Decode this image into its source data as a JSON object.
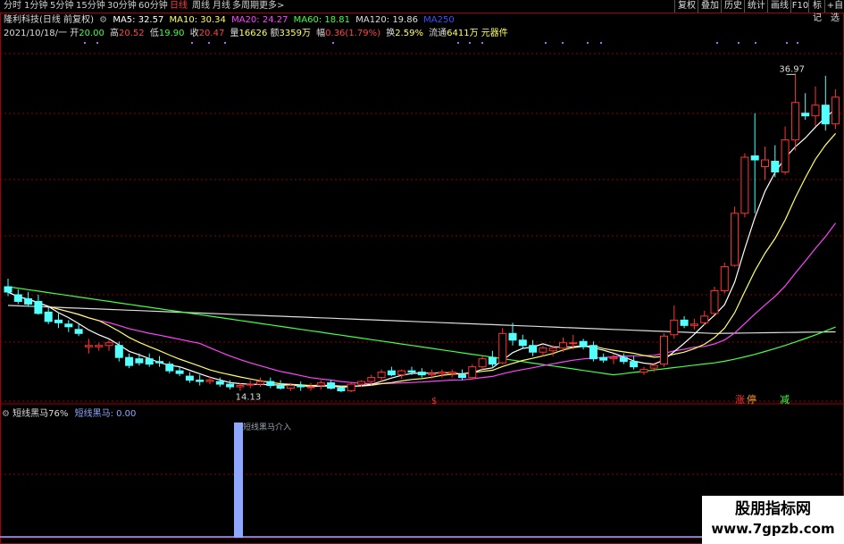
{
  "timeframes": [
    {
      "label": "分时",
      "active": false
    },
    {
      "label": "1分钟",
      "active": false
    },
    {
      "label": "5分钟",
      "active": false
    },
    {
      "label": "15分钟",
      "active": false
    },
    {
      "label": "30分钟",
      "active": false
    },
    {
      "label": "60分钟",
      "active": false
    },
    {
      "label": "日线",
      "active": true
    },
    {
      "label": "周线",
      "active": false
    },
    {
      "label": "月线",
      "active": false
    },
    {
      "label": "多周期",
      "active": false
    },
    {
      "label": "更多>",
      "active": false
    }
  ],
  "right_buttons": [
    "复权",
    "叠加",
    "历史",
    "统计",
    "画线",
    "F10",
    "标记",
    "+自选"
  ],
  "stock_title": "隆利科技(日线 前复权)",
  "ma_legend": [
    {
      "label": "MA5: 32.57",
      "color": "#ffffff"
    },
    {
      "label": "MA10: 30.34",
      "color": "#ffff66"
    },
    {
      "label": "MA20: 24.27",
      "color": "#ff44ff"
    },
    {
      "label": "MA60: 18.81",
      "color": "#44ff44"
    },
    {
      "label": "MA120: 19.86",
      "color": "#dddddd"
    },
    {
      "label": "MA250",
      "color": "#3355ff"
    }
  ],
  "quote": {
    "date": "2021/10/18/一",
    "open_label": "开",
    "open": "20.00",
    "high_label": "高",
    "high": "20.52",
    "low_label": "低",
    "low": "19.90",
    "close_label": "收",
    "close": "20.47",
    "vol_label": "量",
    "vol": "16626",
    "amount_label": "额",
    "amount": "3359万",
    "chg_label": "幅",
    "chg": "0.36(1.79%)",
    "turnover_label": "换",
    "turnover": "2.59%",
    "float_label": "流通",
    "float": "6411万",
    "sector": "元器件"
  },
  "price_labels": {
    "high": "36.97",
    "low": "14.13"
  },
  "markers": {
    "s": "$",
    "zhang": "涨",
    "ting": "停",
    "yu": "减"
  },
  "indicator": {
    "name": "短线黑马76%",
    "value_label": "短线黑马: 0.00",
    "bar_text": "短线黑马介入"
  },
  "colors": {
    "up": "#ff3333",
    "down": "#54ffff",
    "ma5": "#ffffff",
    "ma10": "#ffff66",
    "ma20": "#ff44ff",
    "ma60": "#44ff44",
    "ma120": "#dddddd",
    "grid": "#8b0000",
    "bar": "#8fa8ff"
  },
  "chart_data": {
    "type": "candlestick",
    "ylim": [
      12.5,
      39
    ],
    "candles": [
      {
        "o": 21.0,
        "h": 21.6,
        "l": 20.3,
        "c": 20.6
      },
      {
        "o": 20.4,
        "h": 20.8,
        "l": 19.7,
        "c": 19.9
      },
      {
        "o": 20.1,
        "h": 20.6,
        "l": 19.5,
        "c": 19.7
      },
      {
        "o": 19.9,
        "h": 20.4,
        "l": 18.9,
        "c": 19.0
      },
      {
        "o": 19.1,
        "h": 19.5,
        "l": 18.2,
        "c": 18.4
      },
      {
        "o": 18.5,
        "h": 19.0,
        "l": 17.9,
        "c": 18.3
      },
      {
        "o": 18.2,
        "h": 18.5,
        "l": 17.6,
        "c": 18.0
      },
      {
        "o": 17.8,
        "h": 18.2,
        "l": 17.3,
        "c": 17.5
      },
      {
        "o": 16.5,
        "h": 17.1,
        "l": 16.0,
        "c": 16.6
      },
      {
        "o": 16.5,
        "h": 16.8,
        "l": 16.2,
        "c": 16.6
      },
      {
        "o": 16.6,
        "h": 17.0,
        "l": 16.2,
        "c": 16.8
      },
      {
        "o": 16.6,
        "h": 16.9,
        "l": 15.4,
        "c": 15.7
      },
      {
        "o": 15.7,
        "h": 16.0,
        "l": 14.9,
        "c": 15.1
      },
      {
        "o": 15.6,
        "h": 16.0,
        "l": 15.1,
        "c": 15.3
      },
      {
        "o": 15.6,
        "h": 16.0,
        "l": 15.0,
        "c": 15.2
      },
      {
        "o": 15.4,
        "h": 15.8,
        "l": 15.0,
        "c": 15.3
      },
      {
        "o": 15.2,
        "h": 15.4,
        "l": 14.5,
        "c": 14.7
      },
      {
        "o": 14.7,
        "h": 15.0,
        "l": 14.3,
        "c": 14.5
      },
      {
        "o": 14.3,
        "h": 14.6,
        "l": 13.8,
        "c": 14.0
      },
      {
        "o": 14.0,
        "h": 14.4,
        "l": 13.6,
        "c": 13.9
      },
      {
        "o": 13.9,
        "h": 14.3,
        "l": 13.7,
        "c": 14.0
      },
      {
        "o": 13.9,
        "h": 14.2,
        "l": 13.5,
        "c": 13.7
      },
      {
        "o": 13.7,
        "h": 14.0,
        "l": 13.3,
        "c": 13.5
      },
      {
        "o": 13.5,
        "h": 13.8,
        "l": 13.2,
        "c": 13.6
      },
      {
        "o": 13.7,
        "h": 14.0,
        "l": 13.4,
        "c": 13.7
      },
      {
        "o": 13.7,
        "h": 14.2,
        "l": 13.5,
        "c": 13.9
      },
      {
        "o": 13.9,
        "h": 14.2,
        "l": 13.4,
        "c": 13.6
      },
      {
        "o": 13.6,
        "h": 14.0,
        "l": 13.3,
        "c": 13.4
      },
      {
        "o": 13.4,
        "h": 13.8,
        "l": 13.2,
        "c": 13.6
      },
      {
        "o": 13.6,
        "h": 13.9,
        "l": 13.2,
        "c": 13.5
      },
      {
        "o": 13.5,
        "h": 13.8,
        "l": 13.2,
        "c": 13.5
      },
      {
        "o": 13.6,
        "h": 14.0,
        "l": 13.3,
        "c": 13.8
      },
      {
        "o": 13.8,
        "h": 14.0,
        "l": 13.3,
        "c": 13.4
      },
      {
        "o": 13.4,
        "h": 13.6,
        "l": 13.1,
        "c": 13.2
      },
      {
        "o": 13.2,
        "h": 13.8,
        "l": 13.1,
        "c": 13.7
      },
      {
        "o": 13.7,
        "h": 14.0,
        "l": 13.5,
        "c": 13.9
      },
      {
        "o": 13.9,
        "h": 14.4,
        "l": 13.6,
        "c": 14.2
      },
      {
        "o": 14.2,
        "h": 14.8,
        "l": 13.9,
        "c": 14.6
      },
      {
        "o": 14.7,
        "h": 15.0,
        "l": 14.3,
        "c": 14.4
      },
      {
        "o": 14.4,
        "h": 14.8,
        "l": 14.1,
        "c": 14.7
      },
      {
        "o": 14.7,
        "h": 15.0,
        "l": 14.4,
        "c": 14.6
      },
      {
        "o": 14.6,
        "h": 14.9,
        "l": 14.2,
        "c": 14.4
      },
      {
        "o": 14.4,
        "h": 14.8,
        "l": 14.1,
        "c": 14.5
      },
      {
        "o": 14.5,
        "h": 14.8,
        "l": 14.2,
        "c": 14.6
      },
      {
        "o": 14.5,
        "h": 14.8,
        "l": 14.2,
        "c": 14.6
      },
      {
        "o": 14.4,
        "h": 14.8,
        "l": 14.0,
        "c": 14.2
      },
      {
        "o": 14.2,
        "h": 15.2,
        "l": 14.1,
        "c": 15.0
      },
      {
        "o": 15.0,
        "h": 15.8,
        "l": 14.8,
        "c": 15.6
      },
      {
        "o": 15.7,
        "h": 16.2,
        "l": 15.0,
        "c": 15.2
      },
      {
        "o": 15.3,
        "h": 17.9,
        "l": 15.2,
        "c": 17.5
      },
      {
        "o": 17.5,
        "h": 18.3,
        "l": 16.6,
        "c": 17.0
      },
      {
        "o": 17.0,
        "h": 17.4,
        "l": 16.4,
        "c": 16.6
      },
      {
        "o": 16.6,
        "h": 17.0,
        "l": 15.8,
        "c": 16.1
      },
      {
        "o": 16.1,
        "h": 16.6,
        "l": 15.8,
        "c": 16.4
      },
      {
        "o": 16.2,
        "h": 16.6,
        "l": 15.8,
        "c": 16.4
      },
      {
        "o": 16.4,
        "h": 17.2,
        "l": 16.1,
        "c": 16.8
      },
      {
        "o": 16.8,
        "h": 17.4,
        "l": 16.3,
        "c": 16.8
      },
      {
        "o": 16.9,
        "h": 17.1,
        "l": 16.3,
        "c": 16.5
      },
      {
        "o": 16.6,
        "h": 16.9,
        "l": 15.4,
        "c": 15.6
      },
      {
        "o": 15.7,
        "h": 16.0,
        "l": 15.3,
        "c": 15.5
      },
      {
        "o": 15.6,
        "h": 16.0,
        "l": 15.2,
        "c": 15.7
      },
      {
        "o": 15.7,
        "h": 16.0,
        "l": 15.2,
        "c": 15.4
      },
      {
        "o": 15.4,
        "h": 15.8,
        "l": 14.8,
        "c": 15.0
      },
      {
        "o": 14.6,
        "h": 15.0,
        "l": 14.4,
        "c": 14.8
      },
      {
        "o": 14.9,
        "h": 15.3,
        "l": 14.6,
        "c": 15.1
      },
      {
        "o": 15.2,
        "h": 17.5,
        "l": 15.0,
        "c": 17.3
      },
      {
        "o": 17.4,
        "h": 19.6,
        "l": 17.1,
        "c": 18.5
      },
      {
        "o": 18.5,
        "h": 18.8,
        "l": 17.9,
        "c": 18.1
      },
      {
        "o": 18.1,
        "h": 18.6,
        "l": 17.8,
        "c": 18.2
      },
      {
        "o": 18.3,
        "h": 19.2,
        "l": 18.1,
        "c": 18.8
      },
      {
        "o": 19.0,
        "h": 21.0,
        "l": 18.9,
        "c": 20.7
      },
      {
        "o": 20.7,
        "h": 22.8,
        "l": 20.5,
        "c": 22.5
      },
      {
        "o": 22.6,
        "h": 27.0,
        "l": 22.5,
        "c": 26.5
      },
      {
        "o": 26.5,
        "h": 31.0,
        "l": 26.2,
        "c": 30.7
      },
      {
        "o": 30.8,
        "h": 34.0,
        "l": 26.5,
        "c": 30.5
      },
      {
        "o": 30.0,
        "h": 31.5,
        "l": 29.0,
        "c": 30.5
      },
      {
        "o": 30.4,
        "h": 31.6,
        "l": 29.2,
        "c": 29.6
      },
      {
        "o": 29.6,
        "h": 33.0,
        "l": 29.4,
        "c": 32.0
      },
      {
        "o": 32.0,
        "h": 36.97,
        "l": 31.2,
        "c": 34.8
      },
      {
        "o": 34.0,
        "h": 35.5,
        "l": 33.5,
        "c": 33.8
      },
      {
        "o": 33.8,
        "h": 36.0,
        "l": 33.0,
        "c": 34.6
      },
      {
        "o": 34.6,
        "h": 36.8,
        "l": 32.7,
        "c": 33.2
      },
      {
        "o": 33.2,
        "h": 35.8,
        "l": 32.8,
        "c": 35.2
      }
    ]
  }
}
